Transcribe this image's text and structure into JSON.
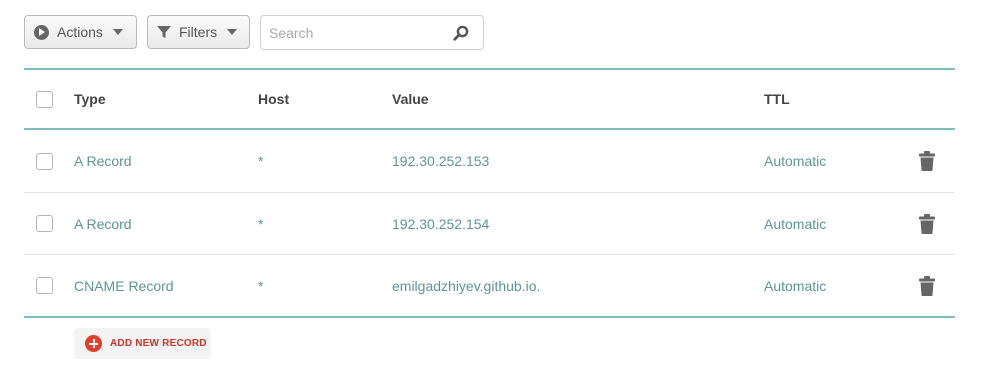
{
  "toolbar": {
    "actions_label": "Actions",
    "filters_label": "Filters",
    "search_placeholder": "Search"
  },
  "table": {
    "headers": {
      "type": "Type",
      "host": "Host",
      "value": "Value",
      "ttl": "TTL"
    },
    "rows": [
      {
        "type": "A Record",
        "host": "*",
        "value": "192.30.252.153",
        "ttl": "Automatic"
      },
      {
        "type": "A Record",
        "host": "*",
        "value": "192.30.252.154",
        "ttl": "Automatic"
      },
      {
        "type": "CNAME Record",
        "host": "*",
        "value": "emilgadzhiyev.github.io.",
        "ttl": "Automatic"
      }
    ]
  },
  "add_record": {
    "label": "ADD NEW RECORD"
  },
  "colors": {
    "accent": "#7fbfbc",
    "link_text": "#5d9592",
    "add_red": "#e0402a"
  }
}
